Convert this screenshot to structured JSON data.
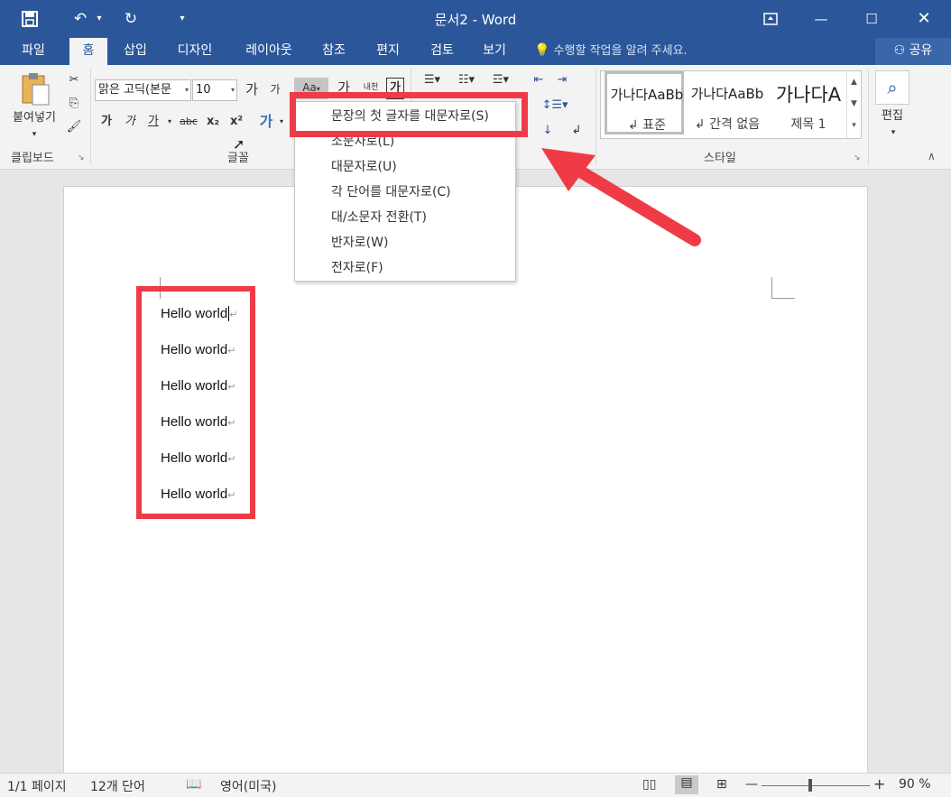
{
  "window": {
    "title": "문서2 - Word"
  },
  "quick_access": {
    "save_icon": "save-icon",
    "undo_icon": "undo-icon",
    "redo_icon": "redo-icon",
    "customize_icon": "customize-qat-icon"
  },
  "tabs": [
    {
      "label": "파일",
      "active": false
    },
    {
      "label": "홈",
      "active": true
    },
    {
      "label": "삽입",
      "active": false
    },
    {
      "label": "디자인",
      "active": false
    },
    {
      "label": "레이아웃",
      "active": false
    },
    {
      "label": "참조",
      "active": false
    },
    {
      "label": "편지",
      "active": false
    },
    {
      "label": "검토",
      "active": false
    },
    {
      "label": "보기",
      "active": false
    }
  ],
  "tell_me": "수행할 작업을 알려 주세요.",
  "share": "공유",
  "clipboard": {
    "paste_label": "붙여넣기",
    "group_label": "클립보드"
  },
  "font": {
    "name": "맑은 고딕(본문",
    "size": "10",
    "group_label": "글꼴",
    "grow": "가",
    "shrink": "가",
    "case_btn": "Aa",
    "bold": "가",
    "italic": "가",
    "underline": "가",
    "strike": "abc",
    "sub": "x₂",
    "sup": "x²",
    "effects": "가",
    "clear": "가",
    "phonetic": "내천",
    "border_char": "가"
  },
  "styles": {
    "group_label": "스타일",
    "items": [
      {
        "preview": "가나다AaBb",
        "name": "↲ 표준"
      },
      {
        "preview": "가나다AaBb",
        "name": "↲ 간격 없음"
      },
      {
        "preview": "가나다A",
        "name": "제목 1"
      }
    ]
  },
  "editing": {
    "label": "편집"
  },
  "case_menu": {
    "items": [
      {
        "label": "문장의 첫 글자를 대문자로(S)"
      },
      {
        "label": "소문자로(L)"
      },
      {
        "label": "대문자로(U)"
      },
      {
        "label": "각 단어를 대문자로(C)"
      },
      {
        "label": "대/소문자 전환(T)"
      },
      {
        "label": "반자로(W)"
      },
      {
        "label": "전자로(F)"
      }
    ]
  },
  "document": {
    "lines": [
      "Hello world",
      "Hello world",
      "Hello world",
      "Hello world",
      "Hello world",
      "Hello world"
    ],
    "para_mark": "↵"
  },
  "status": {
    "page": "1/1 페이지",
    "words": "12개 단어",
    "lang": "영어(미국)",
    "zoom": "90 %"
  },
  "colors": {
    "brand": "#2b579a",
    "highlight": "#ef3b46"
  }
}
